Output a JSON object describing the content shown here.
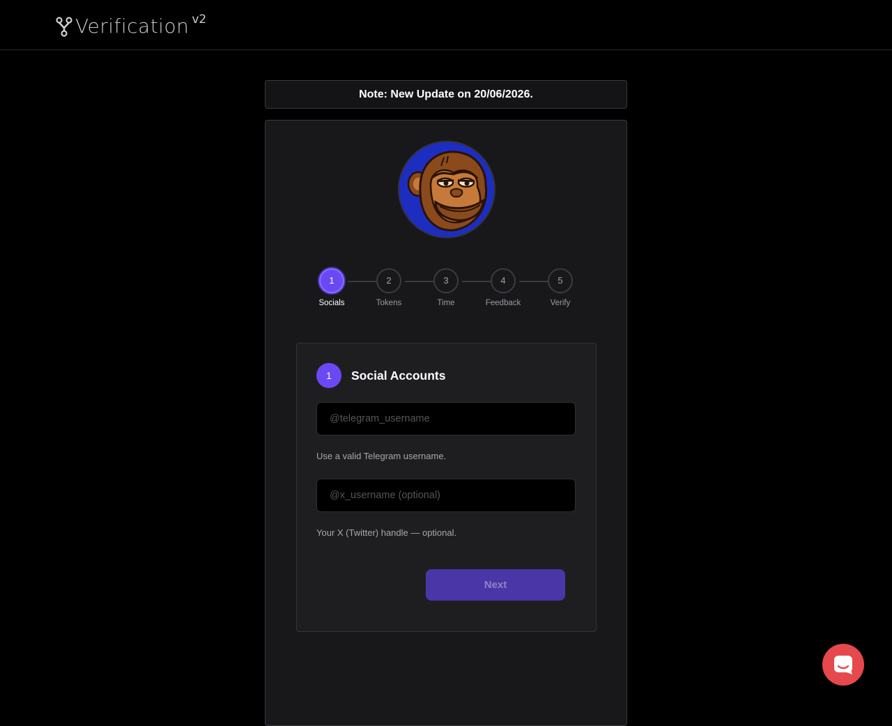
{
  "header": {
    "brand_name": "Verification",
    "brand_version": "v2"
  },
  "note": {
    "text": "Note: New Update on 20/06/2026."
  },
  "avatar": {
    "icon": "ape-avatar-icon",
    "background_color": "#1c2dc0"
  },
  "stepper": {
    "active_step": 1,
    "steps": [
      {
        "number": "1",
        "label": "Socials"
      },
      {
        "number": "2",
        "label": "Tokens"
      },
      {
        "number": "3",
        "label": "Time"
      },
      {
        "number": "4",
        "label": "Feedback"
      },
      {
        "number": "5",
        "label": "Verify"
      }
    ]
  },
  "card": {
    "badge": "1",
    "title": "Social Accounts",
    "telegram": {
      "value": "",
      "placeholder": "@telegram_username",
      "hint": "Use a valid Telegram username."
    },
    "x_handle": {
      "value": "",
      "placeholder": "@x_username (optional)",
      "hint": "Your X (Twitter) handle — optional."
    },
    "next_label": "Next"
  },
  "chat": {
    "icon": "chat-bubble-icon"
  },
  "colors": {
    "accent": "#6a49f5",
    "accent_disabled": "#4b36a8",
    "chat_button": "#e5484d",
    "background": "#000000",
    "panel": "#18181b"
  }
}
